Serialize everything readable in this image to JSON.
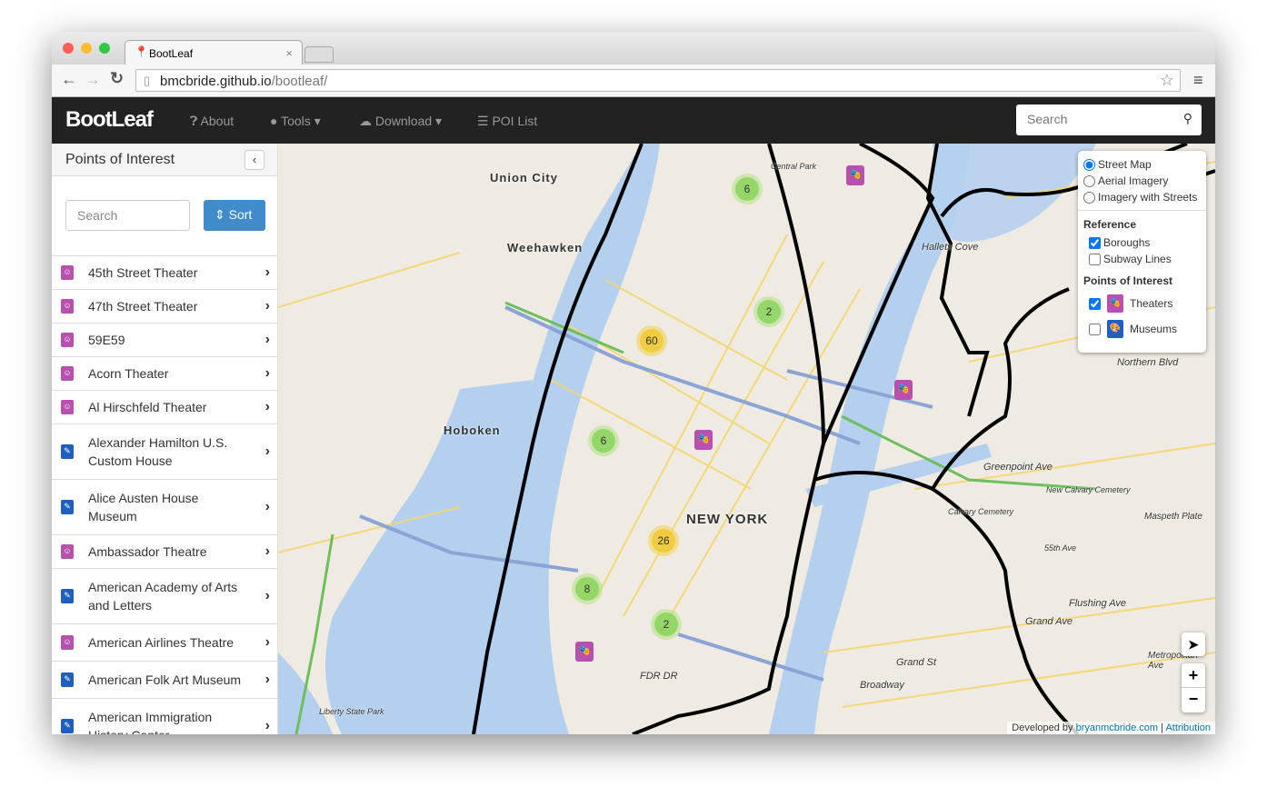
{
  "browser": {
    "tab_title": "BootLeaf",
    "url_host": "bmcbride.github.io",
    "url_path": "/bootleaf/"
  },
  "navbar": {
    "brand": "BootLeaf",
    "items": [
      {
        "label": "About",
        "icon": "question-circle-icon"
      },
      {
        "label": "Tools",
        "icon": "globe-icon",
        "caret": true
      },
      {
        "label": "Download",
        "icon": "cloud-download-icon",
        "caret": true
      },
      {
        "label": "POI List",
        "icon": "list-icon"
      }
    ],
    "search_placeholder": "Search"
  },
  "sidebar": {
    "title": "Points of Interest",
    "search_placeholder": "Search",
    "sort_label": "Sort",
    "items": [
      {
        "label": "45th Street Theater",
        "type": "theater"
      },
      {
        "label": "47th Street Theater",
        "type": "theater"
      },
      {
        "label": "59E59",
        "type": "theater"
      },
      {
        "label": "Acorn Theater",
        "type": "theater"
      },
      {
        "label": "Al Hirschfeld Theater",
        "type": "theater"
      },
      {
        "label": "Alexander Hamilton U.S. Custom House",
        "type": "museum"
      },
      {
        "label": "Alice Austen House Museum",
        "type": "museum"
      },
      {
        "label": "Ambassador Theatre",
        "type": "theater"
      },
      {
        "label": "American Academy of Arts and Letters",
        "type": "museum"
      },
      {
        "label": "American Airlines Theatre",
        "type": "theater"
      },
      {
        "label": "American Folk Art Museum",
        "type": "museum"
      },
      {
        "label": "American Immigration History Center",
        "type": "museum"
      }
    ]
  },
  "colors": {
    "theater": "#b94fae",
    "museum": "#1f5fbf",
    "cluster_small": "#8fd15a",
    "cluster_medium": "#f0c93a",
    "accent": "#428bca"
  },
  "map": {
    "labels": [
      "Union City",
      "Weehawken",
      "Hoboken",
      "NEW YORK",
      "Hallets Cove",
      "Calvary Cemetery",
      "New Calvary Cemetery",
      "Maspeth Plate",
      "Liberty State Park",
      "Central Park",
      "Metropolitan Ave",
      "Grand Ave",
      "Flushing Ave",
      "Broadway",
      "Grand St",
      "FDR DR",
      "Greenpoint Ave",
      "Northern Blvd",
      "55th Ave"
    ],
    "clusters": [
      {
        "count": "6",
        "size": "small"
      },
      {
        "count": "2",
        "size": "small"
      },
      {
        "count": "60",
        "size": "medium"
      },
      {
        "count": "6",
        "size": "small"
      },
      {
        "count": "26",
        "size": "medium"
      },
      {
        "count": "8",
        "size": "small"
      },
      {
        "count": "2",
        "size": "small"
      }
    ],
    "layer_control": {
      "basemaps": [
        {
          "label": "Street Map",
          "selected": true
        },
        {
          "label": "Aerial Imagery",
          "selected": false
        },
        {
          "label": "Imagery with Streets",
          "selected": false
        }
      ],
      "reference_title": "Reference",
      "reference": [
        {
          "label": "Boroughs",
          "checked": true
        },
        {
          "label": "Subway Lines",
          "checked": false
        }
      ],
      "poi_title": "Points of Interest",
      "poi": [
        {
          "label": "Theaters",
          "checked": true
        },
        {
          "label": "Museums",
          "checked": false
        }
      ]
    },
    "zoom_in": "+",
    "zoom_out": "−",
    "attribution": {
      "prefix": "Developed by",
      "link": "bryanmcbride.com",
      "sep": "|",
      "attribution": "Attribution"
    }
  }
}
